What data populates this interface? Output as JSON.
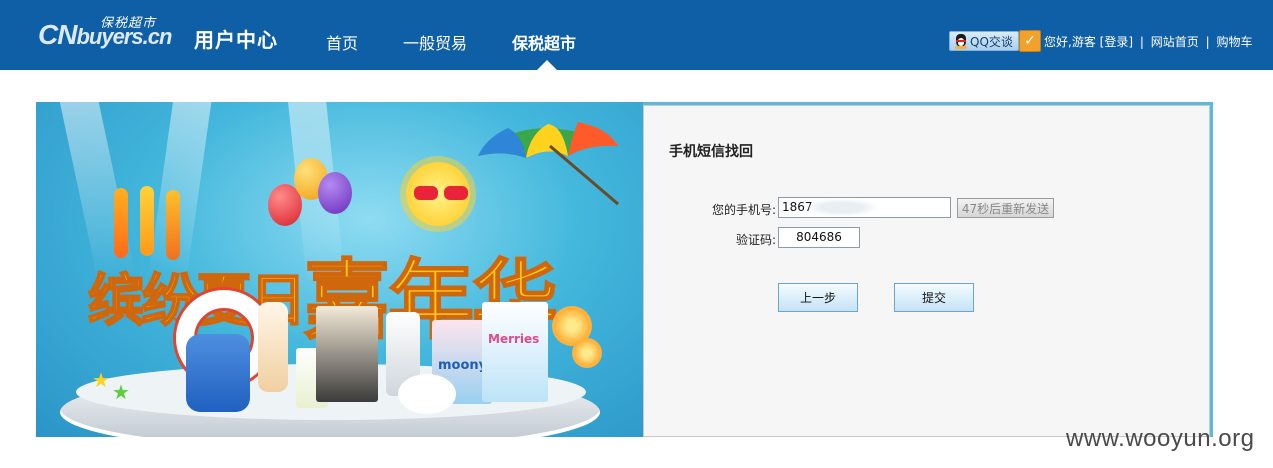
{
  "header": {
    "logo_main": "CN",
    "logo_rest": "buyers.cn",
    "logo_sub": "保税超市",
    "section_title": "用户中心",
    "nav": [
      {
        "label": "首页"
      },
      {
        "label": "一般贸易"
      },
      {
        "label": "保税超市"
      }
    ],
    "active_nav": "保税超市",
    "qq_label": "QQ交谈",
    "greeting": "您好,游客",
    "login_link": "[登录]",
    "home_link": "网站首页",
    "cart_link": "购物车",
    "separator": "|",
    "colors": {
      "bar": "#0f5fa6",
      "text": "#ffffff"
    }
  },
  "banner": {
    "headline": "缤纷夏日",
    "headline_big": "嘉年华",
    "product_labels": [
      "moony",
      "Merries"
    ],
    "icons": [
      "umbrella-icon",
      "sun-icon",
      "balloon-icon",
      "life-ring-icon",
      "flower-icon",
      "star-icon"
    ]
  },
  "form": {
    "title": "手机短信找回",
    "phone_label": "您的手机号:",
    "phone_value": "1867",
    "resend_label": "47秒后重新发送",
    "code_label": "验证码:",
    "code_value": "804686",
    "prev_label": "上一步",
    "submit_label": "提交",
    "colors": {
      "panel_border": "#5bb9e0",
      "button_border": "#6aa6d4"
    }
  },
  "watermark": "www.wooyun.org"
}
